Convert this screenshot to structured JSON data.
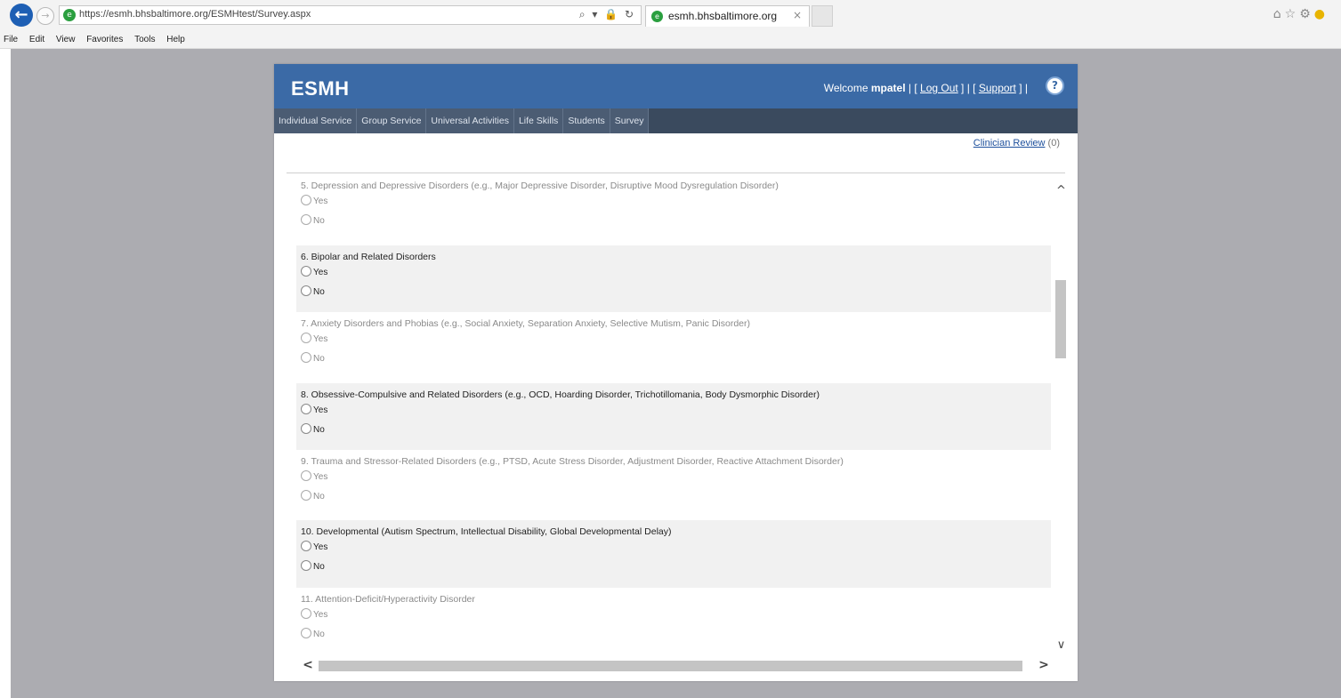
{
  "browser": {
    "back_glyph": "←",
    "forward_glyph": "→",
    "url": "https://esmh.bhsbaltimore.org/ESMHtest/Survey.aspx",
    "url_controls": "⌕ ▾ 🔒 ↻",
    "tab_title": "esmh.bhsbaltimore.org",
    "tab_close": "×",
    "icons": [
      "home-icon",
      "favorites-icon",
      "settings-icon",
      "smiley-icon"
    ],
    "menu": [
      "File",
      "Edit",
      "View",
      "Favorites",
      "Tools",
      "Help"
    ]
  },
  "app": {
    "title": "ESMH",
    "welcome_prefix": "Welcome",
    "username": "mpatel",
    "logout_label": "Log Out",
    "support_label": "Support",
    "help_glyph": "?",
    "nav_tabs": [
      "Individual Service",
      "Group Service",
      "Universal Activities",
      "Life Skills",
      "Students",
      "Survey"
    ],
    "clinician_review_label": "Clinician Review",
    "clinician_review_count": "(0)"
  },
  "survey": {
    "questions": [
      {
        "text": "5.  Depression and Depressive Disorders (e.g., Major Depressive Disorder, Disruptive Mood Dysregulation Disorder)",
        "options": [
          "Yes",
          "No"
        ]
      },
      {
        "text": "6.  Bipolar and Related Disorders",
        "options": [
          "Yes",
          "No"
        ]
      },
      {
        "text": "7.  Anxiety Disorders and Phobias (e.g., Social Anxiety, Separation Anxiety, Selective Mutism, Panic Disorder)",
        "options": [
          "Yes",
          "No"
        ]
      },
      {
        "text": "8.  Obsessive-Compulsive and Related Disorders (e.g., OCD, Hoarding Disorder, Trichotillomania, Body Dysmorphic Disorder)",
        "options": [
          "Yes",
          "No"
        ]
      },
      {
        "text": "9.  Trauma and Stressor-Related Disorders (e.g., PTSD, Acute Stress Disorder, Adjustment Disorder, Reactive Attachment Disorder)",
        "options": [
          "Yes",
          "No"
        ]
      },
      {
        "text": "10. Developmental (Autism Spectrum, Intellectual Disability, Global Developmental Delay)",
        "options": [
          "Yes",
          "No"
        ]
      },
      {
        "text": "11. Attention-Deficit/Hyperactivity Disorder",
        "options": [
          "Yes",
          "No"
        ]
      }
    ]
  },
  "scrollbars": {
    "up": "ⱏ",
    "down": "∨",
    "left": "<",
    "right": ">"
  }
}
